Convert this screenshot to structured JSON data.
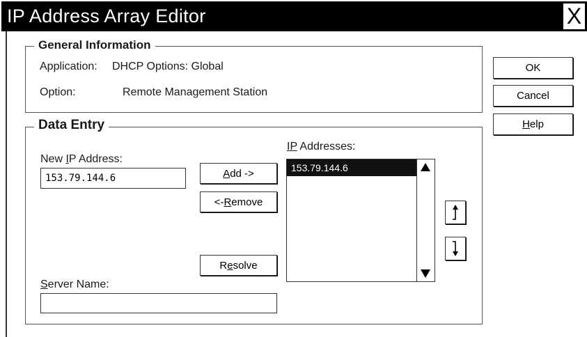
{
  "window": {
    "title": "IP Address Array Editor",
    "close_label": "X"
  },
  "general": {
    "legend": "General Information",
    "application_label": "Application:",
    "application_value": "DHCP Options: Global",
    "option_label": "Option:",
    "option_value": "Remote Management Station"
  },
  "data_entry": {
    "legend": "Data Entry",
    "new_ip_label_pre": "New ",
    "new_ip_label_u": "I",
    "new_ip_label_post": "P Address:",
    "new_ip_value": "153.79.144.6",
    "add_u": "A",
    "add_rest": "dd ->",
    "remove_pre": "<- ",
    "remove_u": "R",
    "remove_rest": "emove",
    "resolve_pre": "R",
    "resolve_u": "e",
    "resolve_rest": "solve",
    "ip_list_label_pre": "I",
    "ip_list_label_u": "P",
    "ip_list_label_post": " Addresses:",
    "ip_list": [
      "153.79.144.6"
    ],
    "server_label_u": "S",
    "server_label_rest": "erver Name:",
    "server_value": ""
  },
  "dialog_buttons": {
    "ok": "OK",
    "cancel": "Cancel",
    "help_u": "H",
    "help_rest": "elp"
  },
  "icons": {
    "move_up": "arrow-up-icon",
    "move_down": "arrow-down-icon",
    "scroll_up": "triangle-up-icon",
    "scroll_down": "triangle-down-icon"
  },
  "colors": {
    "titlebar": "#000000",
    "selection": "#111111"
  }
}
